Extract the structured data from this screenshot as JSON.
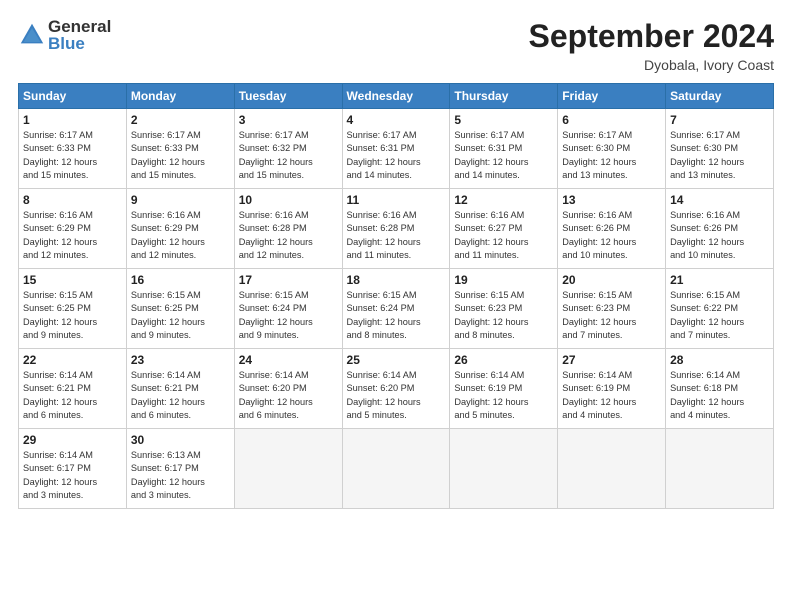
{
  "logo": {
    "general": "General",
    "blue": "Blue"
  },
  "title": "September 2024",
  "location": "Dyobala, Ivory Coast",
  "days_header": [
    "Sunday",
    "Monday",
    "Tuesday",
    "Wednesday",
    "Thursday",
    "Friday",
    "Saturday"
  ],
  "weeks": [
    [
      {
        "day": "1",
        "lines": [
          "Sunrise: 6:17 AM",
          "Sunset: 6:33 PM",
          "Daylight: 12 hours",
          "and 15 minutes."
        ]
      },
      {
        "day": "2",
        "lines": [
          "Sunrise: 6:17 AM",
          "Sunset: 6:33 PM",
          "Daylight: 12 hours",
          "and 15 minutes."
        ]
      },
      {
        "day": "3",
        "lines": [
          "Sunrise: 6:17 AM",
          "Sunset: 6:32 PM",
          "Daylight: 12 hours",
          "and 15 minutes."
        ]
      },
      {
        "day": "4",
        "lines": [
          "Sunrise: 6:17 AM",
          "Sunset: 6:31 PM",
          "Daylight: 12 hours",
          "and 14 minutes."
        ]
      },
      {
        "day": "5",
        "lines": [
          "Sunrise: 6:17 AM",
          "Sunset: 6:31 PM",
          "Daylight: 12 hours",
          "and 14 minutes."
        ]
      },
      {
        "day": "6",
        "lines": [
          "Sunrise: 6:17 AM",
          "Sunset: 6:30 PM",
          "Daylight: 12 hours",
          "and 13 minutes."
        ]
      },
      {
        "day": "7",
        "lines": [
          "Sunrise: 6:17 AM",
          "Sunset: 6:30 PM",
          "Daylight: 12 hours",
          "and 13 minutes."
        ]
      }
    ],
    [
      {
        "day": "8",
        "lines": [
          "Sunrise: 6:16 AM",
          "Sunset: 6:29 PM",
          "Daylight: 12 hours",
          "and 12 minutes."
        ]
      },
      {
        "day": "9",
        "lines": [
          "Sunrise: 6:16 AM",
          "Sunset: 6:29 PM",
          "Daylight: 12 hours",
          "and 12 minutes."
        ]
      },
      {
        "day": "10",
        "lines": [
          "Sunrise: 6:16 AM",
          "Sunset: 6:28 PM",
          "Daylight: 12 hours",
          "and 12 minutes."
        ]
      },
      {
        "day": "11",
        "lines": [
          "Sunrise: 6:16 AM",
          "Sunset: 6:28 PM",
          "Daylight: 12 hours",
          "and 11 minutes."
        ]
      },
      {
        "day": "12",
        "lines": [
          "Sunrise: 6:16 AM",
          "Sunset: 6:27 PM",
          "Daylight: 12 hours",
          "and 11 minutes."
        ]
      },
      {
        "day": "13",
        "lines": [
          "Sunrise: 6:16 AM",
          "Sunset: 6:26 PM",
          "Daylight: 12 hours",
          "and 10 minutes."
        ]
      },
      {
        "day": "14",
        "lines": [
          "Sunrise: 6:16 AM",
          "Sunset: 6:26 PM",
          "Daylight: 12 hours",
          "and 10 minutes."
        ]
      }
    ],
    [
      {
        "day": "15",
        "lines": [
          "Sunrise: 6:15 AM",
          "Sunset: 6:25 PM",
          "Daylight: 12 hours",
          "and 9 minutes."
        ]
      },
      {
        "day": "16",
        "lines": [
          "Sunrise: 6:15 AM",
          "Sunset: 6:25 PM",
          "Daylight: 12 hours",
          "and 9 minutes."
        ]
      },
      {
        "day": "17",
        "lines": [
          "Sunrise: 6:15 AM",
          "Sunset: 6:24 PM",
          "Daylight: 12 hours",
          "and 9 minutes."
        ]
      },
      {
        "day": "18",
        "lines": [
          "Sunrise: 6:15 AM",
          "Sunset: 6:24 PM",
          "Daylight: 12 hours",
          "and 8 minutes."
        ]
      },
      {
        "day": "19",
        "lines": [
          "Sunrise: 6:15 AM",
          "Sunset: 6:23 PM",
          "Daylight: 12 hours",
          "and 8 minutes."
        ]
      },
      {
        "day": "20",
        "lines": [
          "Sunrise: 6:15 AM",
          "Sunset: 6:23 PM",
          "Daylight: 12 hours",
          "and 7 minutes."
        ]
      },
      {
        "day": "21",
        "lines": [
          "Sunrise: 6:15 AM",
          "Sunset: 6:22 PM",
          "Daylight: 12 hours",
          "and 7 minutes."
        ]
      }
    ],
    [
      {
        "day": "22",
        "lines": [
          "Sunrise: 6:14 AM",
          "Sunset: 6:21 PM",
          "Daylight: 12 hours",
          "and 6 minutes."
        ]
      },
      {
        "day": "23",
        "lines": [
          "Sunrise: 6:14 AM",
          "Sunset: 6:21 PM",
          "Daylight: 12 hours",
          "and 6 minutes."
        ]
      },
      {
        "day": "24",
        "lines": [
          "Sunrise: 6:14 AM",
          "Sunset: 6:20 PM",
          "Daylight: 12 hours",
          "and 6 minutes."
        ]
      },
      {
        "day": "25",
        "lines": [
          "Sunrise: 6:14 AM",
          "Sunset: 6:20 PM",
          "Daylight: 12 hours",
          "and 5 minutes."
        ]
      },
      {
        "day": "26",
        "lines": [
          "Sunrise: 6:14 AM",
          "Sunset: 6:19 PM",
          "Daylight: 12 hours",
          "and 5 minutes."
        ]
      },
      {
        "day": "27",
        "lines": [
          "Sunrise: 6:14 AM",
          "Sunset: 6:19 PM",
          "Daylight: 12 hours",
          "and 4 minutes."
        ]
      },
      {
        "day": "28",
        "lines": [
          "Sunrise: 6:14 AM",
          "Sunset: 6:18 PM",
          "Daylight: 12 hours",
          "and 4 minutes."
        ]
      }
    ],
    [
      {
        "day": "29",
        "lines": [
          "Sunrise: 6:14 AM",
          "Sunset: 6:17 PM",
          "Daylight: 12 hours",
          "and 3 minutes."
        ]
      },
      {
        "day": "30",
        "lines": [
          "Sunrise: 6:13 AM",
          "Sunset: 6:17 PM",
          "Daylight: 12 hours",
          "and 3 minutes."
        ]
      },
      {
        "day": "",
        "lines": []
      },
      {
        "day": "",
        "lines": []
      },
      {
        "day": "",
        "lines": []
      },
      {
        "day": "",
        "lines": []
      },
      {
        "day": "",
        "lines": []
      }
    ]
  ]
}
